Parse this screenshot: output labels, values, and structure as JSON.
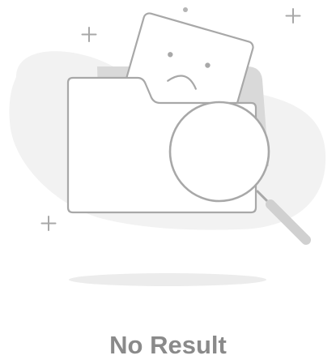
{
  "empty_state": {
    "message": "No Result",
    "illustration_icon": "empty-folder-search-icon"
  },
  "colors": {
    "background": "#ffffff",
    "blob": "#f2f2f2",
    "stroke": "#a8a8a8",
    "dark_fill": "#d9d9d9",
    "text": "#8a8a8a"
  }
}
